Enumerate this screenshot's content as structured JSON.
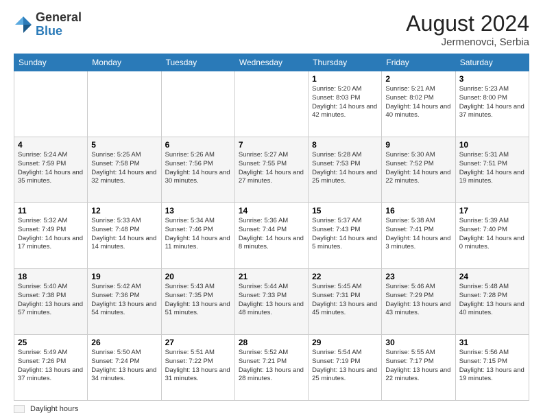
{
  "header": {
    "logo_general": "General",
    "logo_blue": "Blue",
    "month_year": "August 2024",
    "location": "Jermenovci, Serbia"
  },
  "weekdays": [
    "Sunday",
    "Monday",
    "Tuesday",
    "Wednesday",
    "Thursday",
    "Friday",
    "Saturday"
  ],
  "footer": {
    "daylight_label": "Daylight hours"
  },
  "weeks": [
    [
      {
        "day": "",
        "info": ""
      },
      {
        "day": "",
        "info": ""
      },
      {
        "day": "",
        "info": ""
      },
      {
        "day": "",
        "info": ""
      },
      {
        "day": "1",
        "info": "Sunrise: 5:20 AM\nSunset: 8:03 PM\nDaylight: 14 hours\nand 42 minutes."
      },
      {
        "day": "2",
        "info": "Sunrise: 5:21 AM\nSunset: 8:02 PM\nDaylight: 14 hours\nand 40 minutes."
      },
      {
        "day": "3",
        "info": "Sunrise: 5:23 AM\nSunset: 8:00 PM\nDaylight: 14 hours\nand 37 minutes."
      }
    ],
    [
      {
        "day": "4",
        "info": "Sunrise: 5:24 AM\nSunset: 7:59 PM\nDaylight: 14 hours\nand 35 minutes."
      },
      {
        "day": "5",
        "info": "Sunrise: 5:25 AM\nSunset: 7:58 PM\nDaylight: 14 hours\nand 32 minutes."
      },
      {
        "day": "6",
        "info": "Sunrise: 5:26 AM\nSunset: 7:56 PM\nDaylight: 14 hours\nand 30 minutes."
      },
      {
        "day": "7",
        "info": "Sunrise: 5:27 AM\nSunset: 7:55 PM\nDaylight: 14 hours\nand 27 minutes."
      },
      {
        "day": "8",
        "info": "Sunrise: 5:28 AM\nSunset: 7:53 PM\nDaylight: 14 hours\nand 25 minutes."
      },
      {
        "day": "9",
        "info": "Sunrise: 5:30 AM\nSunset: 7:52 PM\nDaylight: 14 hours\nand 22 minutes."
      },
      {
        "day": "10",
        "info": "Sunrise: 5:31 AM\nSunset: 7:51 PM\nDaylight: 14 hours\nand 19 minutes."
      }
    ],
    [
      {
        "day": "11",
        "info": "Sunrise: 5:32 AM\nSunset: 7:49 PM\nDaylight: 14 hours\nand 17 minutes."
      },
      {
        "day": "12",
        "info": "Sunrise: 5:33 AM\nSunset: 7:48 PM\nDaylight: 14 hours\nand 14 minutes."
      },
      {
        "day": "13",
        "info": "Sunrise: 5:34 AM\nSunset: 7:46 PM\nDaylight: 14 hours\nand 11 minutes."
      },
      {
        "day": "14",
        "info": "Sunrise: 5:36 AM\nSunset: 7:44 PM\nDaylight: 14 hours\nand 8 minutes."
      },
      {
        "day": "15",
        "info": "Sunrise: 5:37 AM\nSunset: 7:43 PM\nDaylight: 14 hours\nand 5 minutes."
      },
      {
        "day": "16",
        "info": "Sunrise: 5:38 AM\nSunset: 7:41 PM\nDaylight: 14 hours\nand 3 minutes."
      },
      {
        "day": "17",
        "info": "Sunrise: 5:39 AM\nSunset: 7:40 PM\nDaylight: 14 hours\nand 0 minutes."
      }
    ],
    [
      {
        "day": "18",
        "info": "Sunrise: 5:40 AM\nSunset: 7:38 PM\nDaylight: 13 hours\nand 57 minutes."
      },
      {
        "day": "19",
        "info": "Sunrise: 5:42 AM\nSunset: 7:36 PM\nDaylight: 13 hours\nand 54 minutes."
      },
      {
        "day": "20",
        "info": "Sunrise: 5:43 AM\nSunset: 7:35 PM\nDaylight: 13 hours\nand 51 minutes."
      },
      {
        "day": "21",
        "info": "Sunrise: 5:44 AM\nSunset: 7:33 PM\nDaylight: 13 hours\nand 48 minutes."
      },
      {
        "day": "22",
        "info": "Sunrise: 5:45 AM\nSunset: 7:31 PM\nDaylight: 13 hours\nand 45 minutes."
      },
      {
        "day": "23",
        "info": "Sunrise: 5:46 AM\nSunset: 7:29 PM\nDaylight: 13 hours\nand 43 minutes."
      },
      {
        "day": "24",
        "info": "Sunrise: 5:48 AM\nSunset: 7:28 PM\nDaylight: 13 hours\nand 40 minutes."
      }
    ],
    [
      {
        "day": "25",
        "info": "Sunrise: 5:49 AM\nSunset: 7:26 PM\nDaylight: 13 hours\nand 37 minutes."
      },
      {
        "day": "26",
        "info": "Sunrise: 5:50 AM\nSunset: 7:24 PM\nDaylight: 13 hours\nand 34 minutes."
      },
      {
        "day": "27",
        "info": "Sunrise: 5:51 AM\nSunset: 7:22 PM\nDaylight: 13 hours\nand 31 minutes."
      },
      {
        "day": "28",
        "info": "Sunrise: 5:52 AM\nSunset: 7:21 PM\nDaylight: 13 hours\nand 28 minutes."
      },
      {
        "day": "29",
        "info": "Sunrise: 5:54 AM\nSunset: 7:19 PM\nDaylight: 13 hours\nand 25 minutes."
      },
      {
        "day": "30",
        "info": "Sunrise: 5:55 AM\nSunset: 7:17 PM\nDaylight: 13 hours\nand 22 minutes."
      },
      {
        "day": "31",
        "info": "Sunrise: 5:56 AM\nSunset: 7:15 PM\nDaylight: 13 hours\nand 19 minutes."
      }
    ]
  ]
}
